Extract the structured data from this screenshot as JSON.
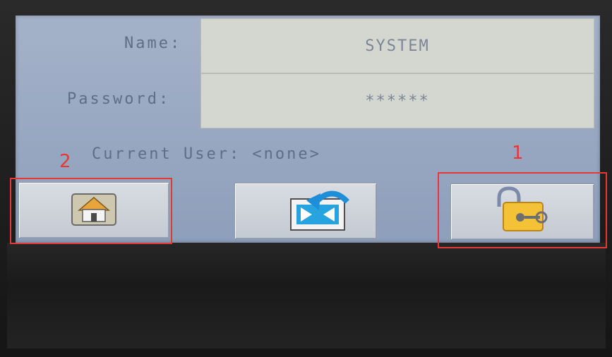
{
  "login": {
    "name_label": "Name:",
    "name_value": "SYSTEM",
    "password_label": "Password:",
    "password_value": "******",
    "current_user_text": "Current User: <none>"
  },
  "buttons": [
    {
      "id": "home",
      "icon": "home-icon"
    },
    {
      "id": "logout",
      "icon": "logout-icon"
    },
    {
      "id": "login",
      "icon": "padlock-key-icon"
    }
  ],
  "annotations": {
    "left_number": "2",
    "right_number": "1"
  },
  "colors": {
    "annotation": "#e53935",
    "screen": "#9aa8c1",
    "field": "#d3d7d0"
  }
}
